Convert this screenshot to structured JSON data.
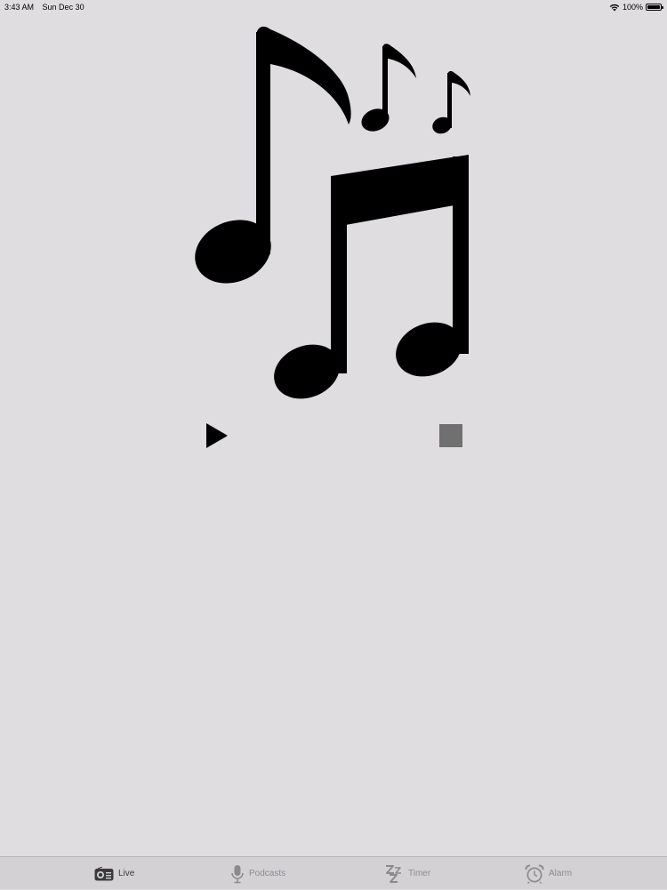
{
  "status_bar": {
    "time": "3:43 AM",
    "date": "Sun Dec 30",
    "battery": "100%"
  },
  "artwork": {
    "icon": "music-notes-icon"
  },
  "controls": {
    "play_icon": "play-icon",
    "stop_icon": "stop-icon"
  },
  "tabs": [
    {
      "label": "Live",
      "icon": "radio-icon",
      "active": true
    },
    {
      "label": "Podcasts",
      "icon": "microphone-icon",
      "active": false
    },
    {
      "label": "Timer",
      "icon": "sleep-zzz-icon",
      "active": false
    },
    {
      "label": "Alarm",
      "icon": "alarm-clock-icon",
      "active": false
    }
  ],
  "colors": {
    "background": "#dfdde0",
    "tab_bar": "#d3d1d4",
    "tab_inactive": "#8b8b8e",
    "tab_active": "#3a3a3c",
    "stop_button": "#707070"
  }
}
